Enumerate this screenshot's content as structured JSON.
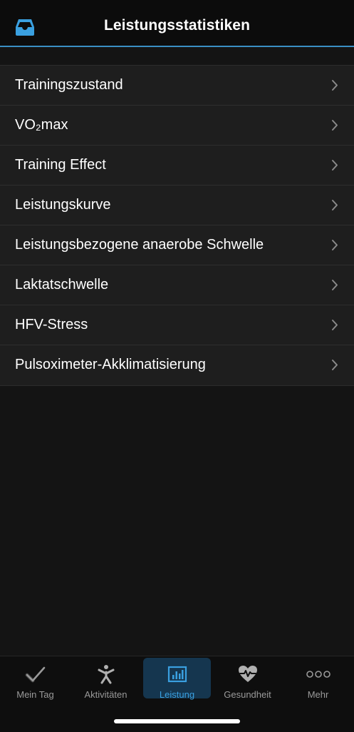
{
  "header": {
    "title": "Leistungsstatistiken",
    "accent_color": "#3aa0e0",
    "inbox_icon": "inbox-icon"
  },
  "list": {
    "items": [
      {
        "label": "Trainingszustand"
      },
      {
        "label": "VO₂max"
      },
      {
        "label": "Training Effect"
      },
      {
        "label": "Leistungskurve"
      },
      {
        "label": "Leistungsbezogene anaerobe Schwelle"
      },
      {
        "label": "Laktatschwelle"
      },
      {
        "label": "HFV-Stress"
      },
      {
        "label": "Pulsoximeter-Akklimatisierung"
      }
    ]
  },
  "tabbar": {
    "tabs": [
      {
        "label": "Mein Tag",
        "icon": "checkmark-icon",
        "active": false
      },
      {
        "label": "Aktivitäten",
        "icon": "person-icon",
        "active": false
      },
      {
        "label": "Leistung",
        "icon": "bar-chart-icon",
        "active": true
      },
      {
        "label": "Gesundheit",
        "icon": "heart-pulse-icon",
        "active": false
      },
      {
        "label": "Mehr",
        "icon": "more-dots-icon",
        "active": false
      }
    ]
  }
}
